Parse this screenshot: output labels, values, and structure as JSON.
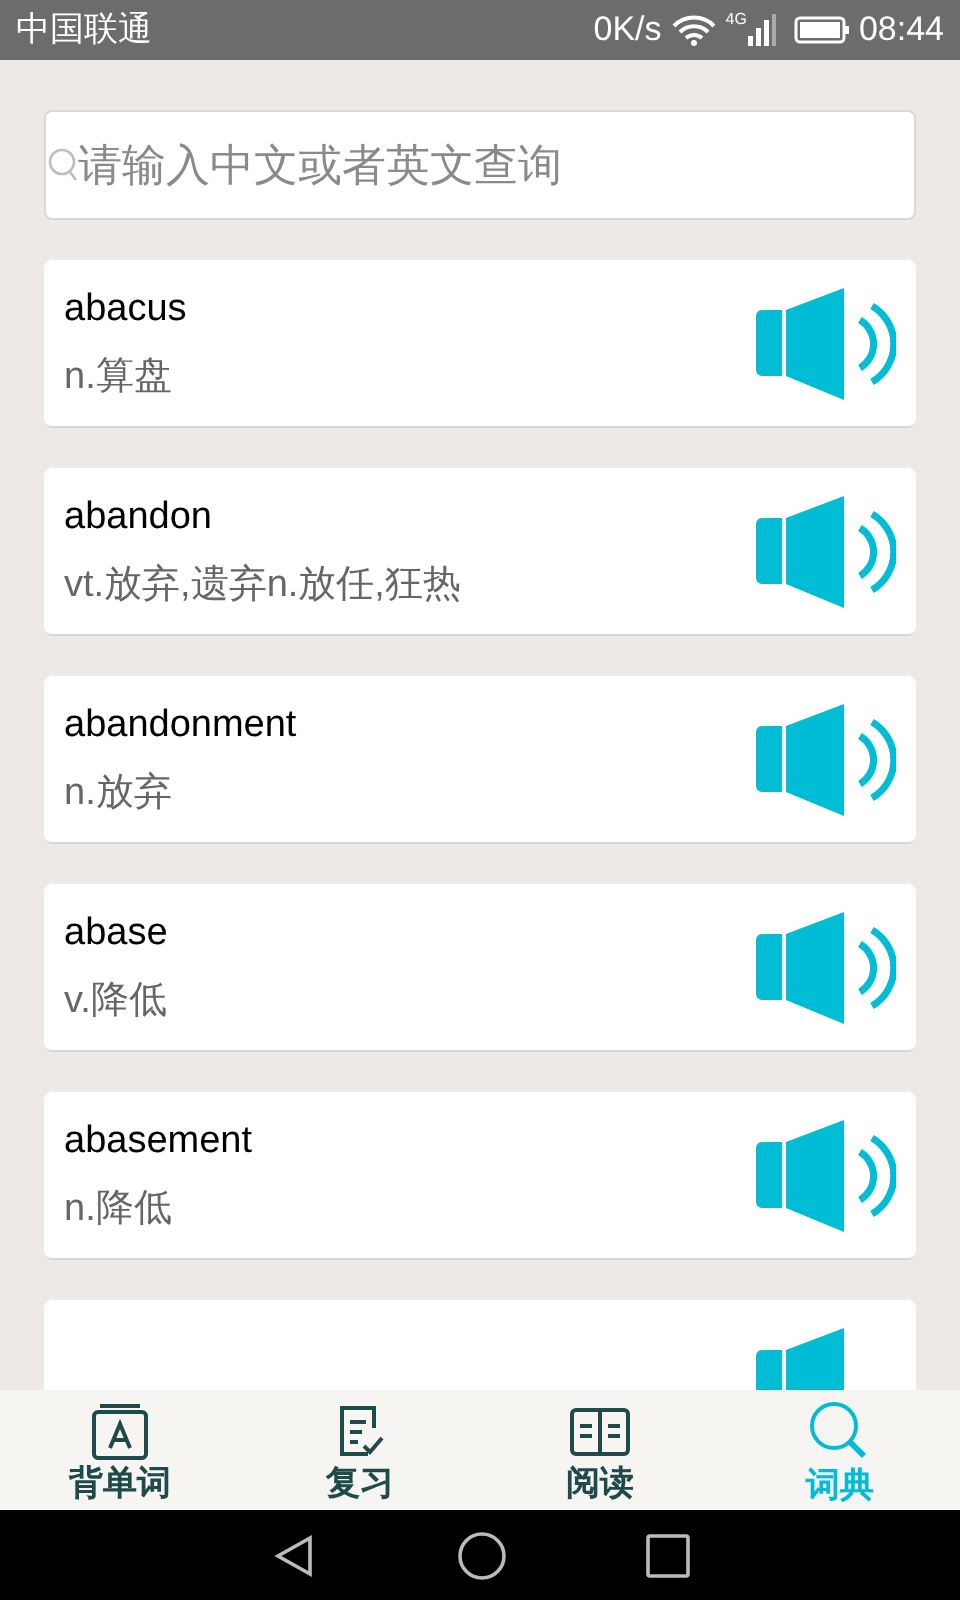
{
  "status_bar": {
    "carrier": "中国联通",
    "speed": "0K/s",
    "network": "4G",
    "time": "08:44"
  },
  "search": {
    "placeholder": "请输入中文或者英文查询"
  },
  "words": [
    {
      "word": "abacus",
      "meaning": "n.算盘"
    },
    {
      "word": "abandon",
      "meaning": "vt.放弃,遗弃n.放任,狂热"
    },
    {
      "word": "abandonment",
      "meaning": "n.放弃"
    },
    {
      "word": "abase",
      "meaning": "v.降低"
    },
    {
      "word": "abasement",
      "meaning": "n.降低"
    }
  ],
  "tabs": [
    {
      "label": "背单词",
      "kind": "card",
      "selected": false
    },
    {
      "label": "复习",
      "kind": "review",
      "selected": false
    },
    {
      "label": "阅读",
      "kind": "book",
      "selected": false
    },
    {
      "label": "词典",
      "kind": "search",
      "selected": true
    }
  ]
}
